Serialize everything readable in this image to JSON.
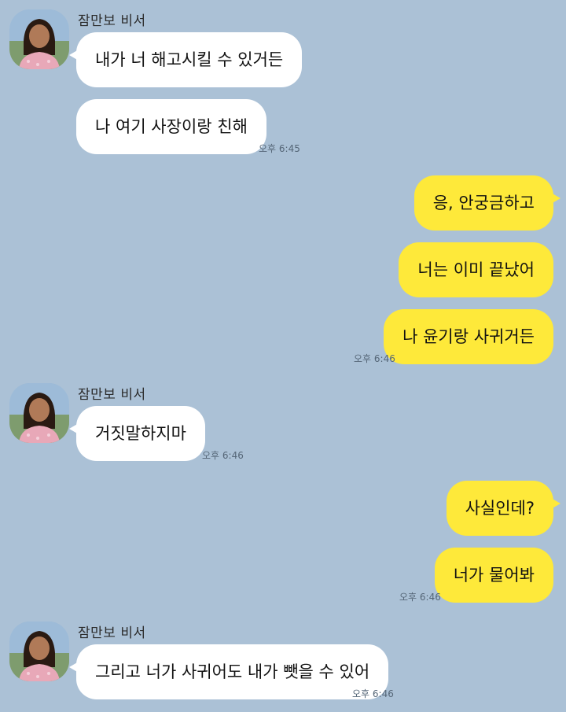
{
  "chat": {
    "bg_color": "#abc1d6",
    "outgoing_color": "#fee93a",
    "incoming_color": "#ffffff",
    "sender_name": "잠만보 비서",
    "messages": [
      {
        "from": "other",
        "text": "내가 너 해고시킬 수 있거든"
      },
      {
        "from": "other",
        "text": "나 여기 사장이랑 친해",
        "time": "오후 6:45"
      },
      {
        "from": "me",
        "text": "응, 안궁금하고"
      },
      {
        "from": "me",
        "text": "너는 이미 끝났어"
      },
      {
        "from": "me",
        "text": "나 윤기랑 사귀거든",
        "time": "오후 6:46"
      },
      {
        "from": "other",
        "text": "거짓말하지마",
        "time": "오후 6:46"
      },
      {
        "from": "me",
        "text": "사실인데?"
      },
      {
        "from": "me",
        "text": "너가 물어봐",
        "time": "오후 6:46"
      },
      {
        "from": "other",
        "text": "그리고 너가 사귀어도 내가 뺏을 수 있어",
        "time": "오후 6:46"
      }
    ]
  }
}
